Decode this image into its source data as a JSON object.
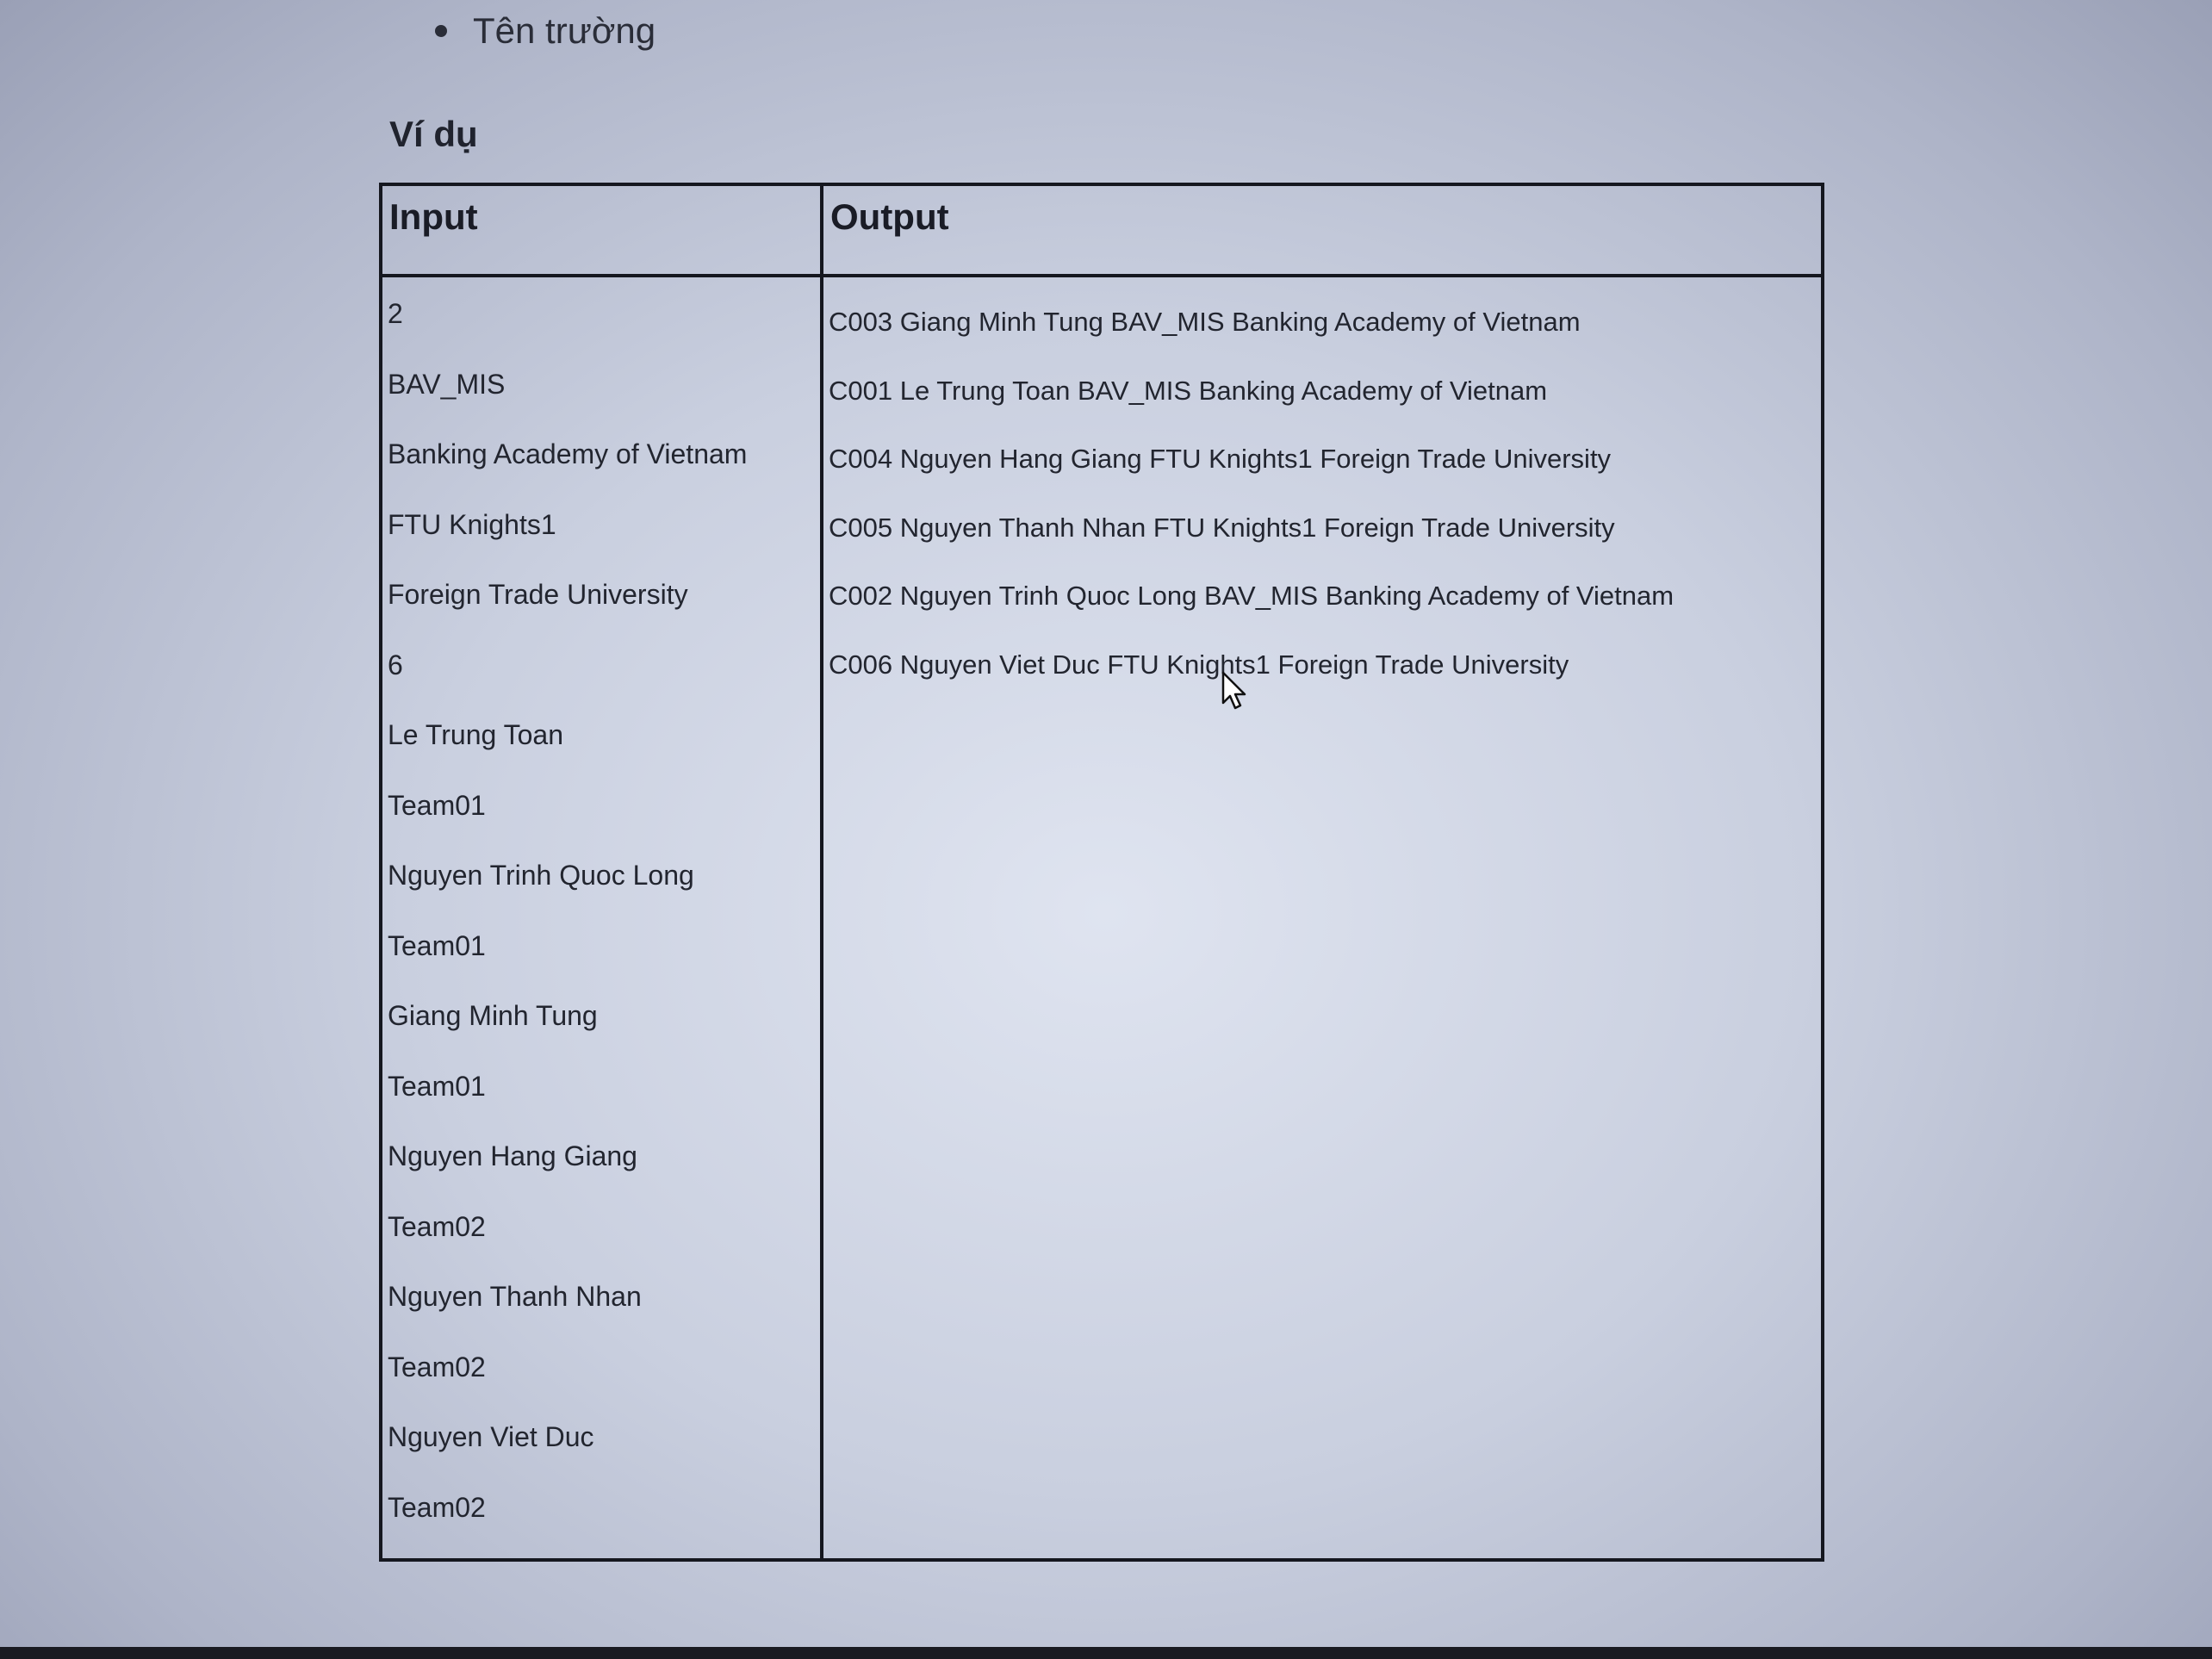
{
  "bullets": [
    "Tên trường"
  ],
  "section_heading": "Ví dụ",
  "table": {
    "headers": {
      "input": "Input",
      "output": "Output"
    },
    "input_lines": [
      "2",
      "BAV_MIS",
      "Banking Academy of Vietnam",
      "FTU Knights1",
      "Foreign Trade University",
      "6",
      "Le Trung Toan",
      "Team01",
      "Nguyen Trinh Quoc Long",
      "Team01",
      "Giang Minh Tung",
      "Team01",
      "Nguyen Hang Giang",
      "Team02",
      "Nguyen Thanh Nhan",
      "Team02",
      "Nguyen Viet Duc",
      "Team02"
    ],
    "output_lines": [
      "C003 Giang Minh Tung BAV_MIS Banking Academy of Vietnam",
      "C001 Le Trung Toan BAV_MIS Banking Academy of Vietnam",
      "C004 Nguyen Hang Giang FTU Knights1 Foreign Trade University",
      "C005 Nguyen Thanh Nhan FTU Knights1 Foreign Trade University",
      "C002 Nguyen Trinh Quoc Long BAV_MIS Banking Academy of Vietnam",
      "C006 Nguyen Viet Duc FTU Knights1 Foreign Trade University"
    ]
  },
  "icons": {
    "cursor": "mouse-pointer-icon"
  }
}
